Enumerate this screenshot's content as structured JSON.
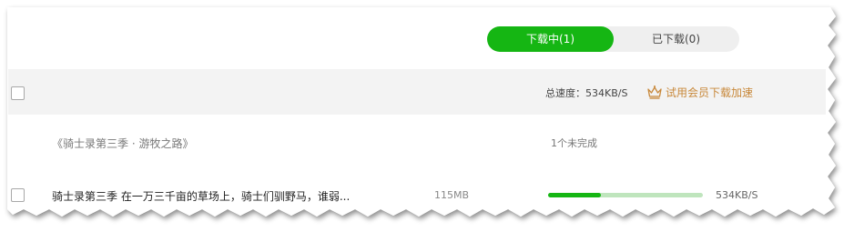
{
  "tabs": {
    "downloading_label": "下载中(1)",
    "downloaded_label": "已下载(0)"
  },
  "toolbar": {
    "total_speed_label": "总速度：534KB/S",
    "vip_trial_label": "试用会员下载加速",
    "vip_icon": "crown-icon"
  },
  "group": {
    "title": "《骑士录第三季 · 游牧之路》",
    "status": "1个未完成"
  },
  "task": {
    "name": "骑士录第三季 在一万三千亩的草场上，骑士们驯野马，谁弱...",
    "size": "115MB",
    "progress": 0.34,
    "speed": "534KB/S"
  },
  "colors": {
    "accent": "#15b613",
    "progress_track": "#bfe5bd",
    "vip": "#c8883a",
    "toolbar_bg": "#f3f3f3"
  }
}
